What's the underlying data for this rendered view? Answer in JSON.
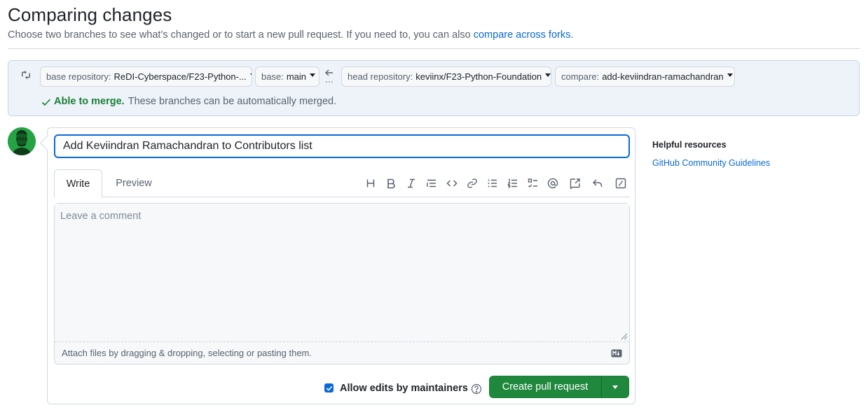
{
  "header": {
    "title": "Comparing changes",
    "subtitle_prefix": "Choose two branches to see what’s changed or to start a new pull request. If you need to, you can also ",
    "subtitle_link": "compare across forks."
  },
  "compare": {
    "base_repo_label": "base repository:",
    "base_repo_value": "ReDI-Cyberspace/F23-Python-...",
    "base_label": "base:",
    "base_value": "main",
    "head_repo_label": "head repository:",
    "head_repo_value": "keviinx/F23-Python-Foundation",
    "compare_label": "compare:",
    "compare_value": "add-keviindran-ramachandran",
    "merge_ok": "Able to merge.",
    "merge_text": "These branches can be automatically merged."
  },
  "form": {
    "title_value": "Add Keviindran Ramachandran to Contributors list",
    "tabs": [
      {
        "label": "Write"
      },
      {
        "label": "Preview"
      }
    ],
    "toolbar_icons": [
      "heading-icon",
      "bold-icon",
      "italic-icon",
      "quote-icon",
      "code-icon",
      "link-icon",
      "unordered-list-icon",
      "ordered-list-icon",
      "task-list-icon",
      "mention-icon",
      "cross-reference-icon",
      "reply-icon",
      "slash-command-icon"
    ],
    "comment_placeholder": "Leave a comment",
    "attach_text": "Attach files by dragging & dropping, selecting or pasting them.",
    "allow_edits_label": "Allow edits by maintainers",
    "allow_edits_checked": true,
    "create_button": "Create pull request"
  },
  "sidebar": {
    "title": "Helpful resources",
    "link": "GitHub Community Guidelines"
  },
  "colors": {
    "accent": "#0969da",
    "success": "#1f883d",
    "compare_bg": "#eef3f9"
  }
}
